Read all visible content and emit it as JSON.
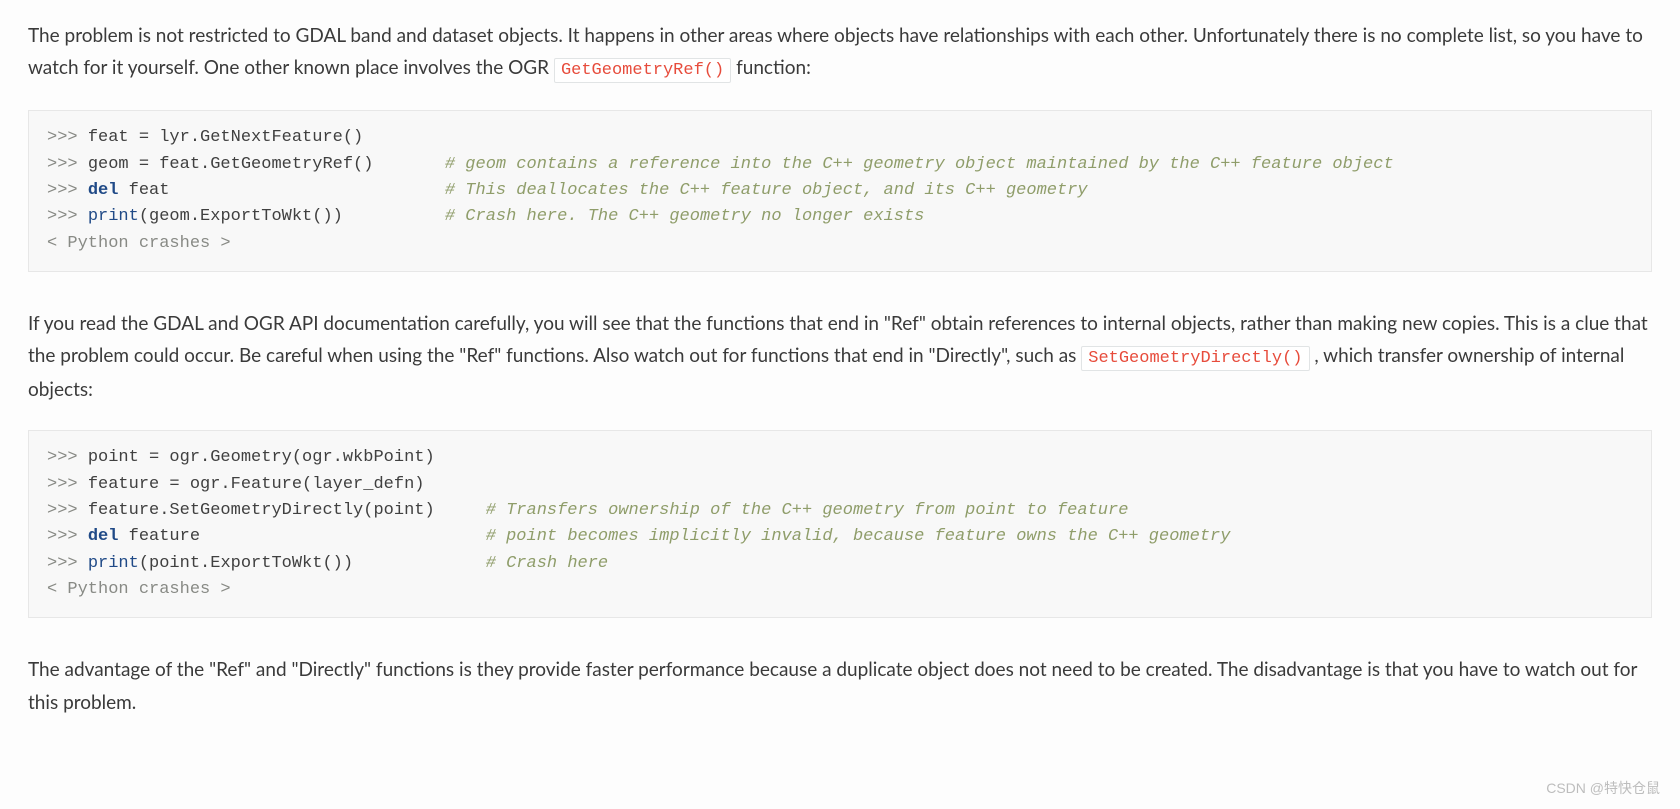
{
  "para1": {
    "before": "The problem is not restricted to GDAL band and dataset objects. It happens in other areas where objects have relationships with each other. Unfortunately there is no complete list, so you have to watch for it yourself. One other known place involves the OGR ",
    "code": "GetGeometryRef()",
    "after": " function:"
  },
  "code1": {
    "l1": {
      "prompt": ">>> ",
      "text": "feat = lyr.GetNextFeature()"
    },
    "l2": {
      "prompt": ">>> ",
      "text": "geom = feat.GetGeometryRef()",
      "pad": "       ",
      "comment": "# geom contains a reference into the C++ geometry object maintained by the C++ feature object"
    },
    "l3": {
      "prompt": ">>> ",
      "kw": "del",
      "rest": " feat",
      "pad": "                           ",
      "comment": "# This deallocates the C++ feature object, and its C++ geometry"
    },
    "l4": {
      "prompt": ">>> ",
      "builtin": "print",
      "rest": "(geom.ExportToWkt())",
      "pad": "          ",
      "comment": "# Crash here. The C++ geometry no longer exists"
    },
    "l5": {
      "output": "< Python crashes >"
    }
  },
  "para2": {
    "before": "If you read the GDAL and OGR API documentation carefully, you will see that the functions that end in \"Ref\" obtain references to internal objects, rather than making new copies. This is a clue that the problem could occur. Be careful when using the \"Ref\" functions. Also watch out for functions that end in \"Directly\", such as ",
    "code": "SetGeometryDirectly()",
    "after": ", which transfer ownership of internal objects:"
  },
  "code2": {
    "l1": {
      "prompt": ">>> ",
      "text": "point = ogr.Geometry(ogr.wkbPoint)"
    },
    "l2": {
      "prompt": ">>> ",
      "text": "feature = ogr.Feature(layer_defn)"
    },
    "l3": {
      "prompt": ">>> ",
      "text": "feature.SetGeometryDirectly(point)",
      "pad": "     ",
      "comment": "# Transfers ownership of the C++ geometry from point to feature"
    },
    "l4": {
      "prompt": ">>> ",
      "kw": "del",
      "rest": " feature",
      "pad": "                            ",
      "comment": "# point becomes implicitly invalid, because feature owns the C++ geometry"
    },
    "l5": {
      "prompt": ">>> ",
      "builtin": "print",
      "rest": "(point.ExportToWkt())",
      "pad": "             ",
      "comment": "# Crash here"
    },
    "l6": {
      "output": "< Python crashes >"
    }
  },
  "para3": "The advantage of the \"Ref\" and \"Directly\" functions is they provide faster performance because a duplicate object does not need to be created. The disadvantage is that you have to watch out for this problem.",
  "watermark": "CSDN @特快仓鼠"
}
